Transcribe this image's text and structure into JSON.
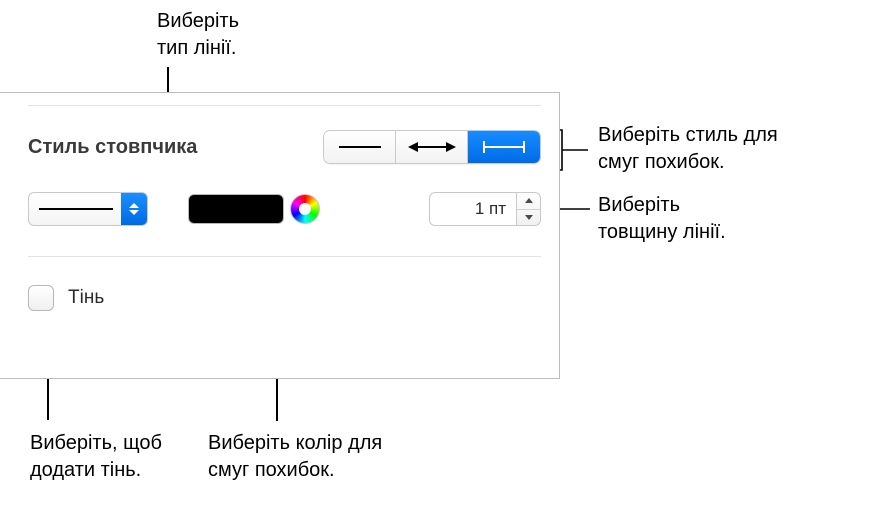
{
  "callouts": {
    "line_type": "Виберіть\nтип лінії.",
    "style": "Виберіть стиль для\nсмуг похибок.",
    "thickness": "Виберіть\nтовщину лінії.",
    "color": "Виберіть колір для\nсмуг похибок.",
    "shadow": "Виберіть, щоб\nдодати тінь."
  },
  "panel": {
    "section_title": "Стиль стовпчика",
    "segments": [
      {
        "name": "barstyle-line",
        "selected": false
      },
      {
        "name": "barstyle-arrow",
        "selected": false
      },
      {
        "name": "barstyle-iBeam",
        "selected": true
      }
    ],
    "line_type_popup_value": "solid",
    "color_swatch": "#000000",
    "thickness_value": "1 пт",
    "shadow_label": "Тінь",
    "shadow_checked": false
  }
}
